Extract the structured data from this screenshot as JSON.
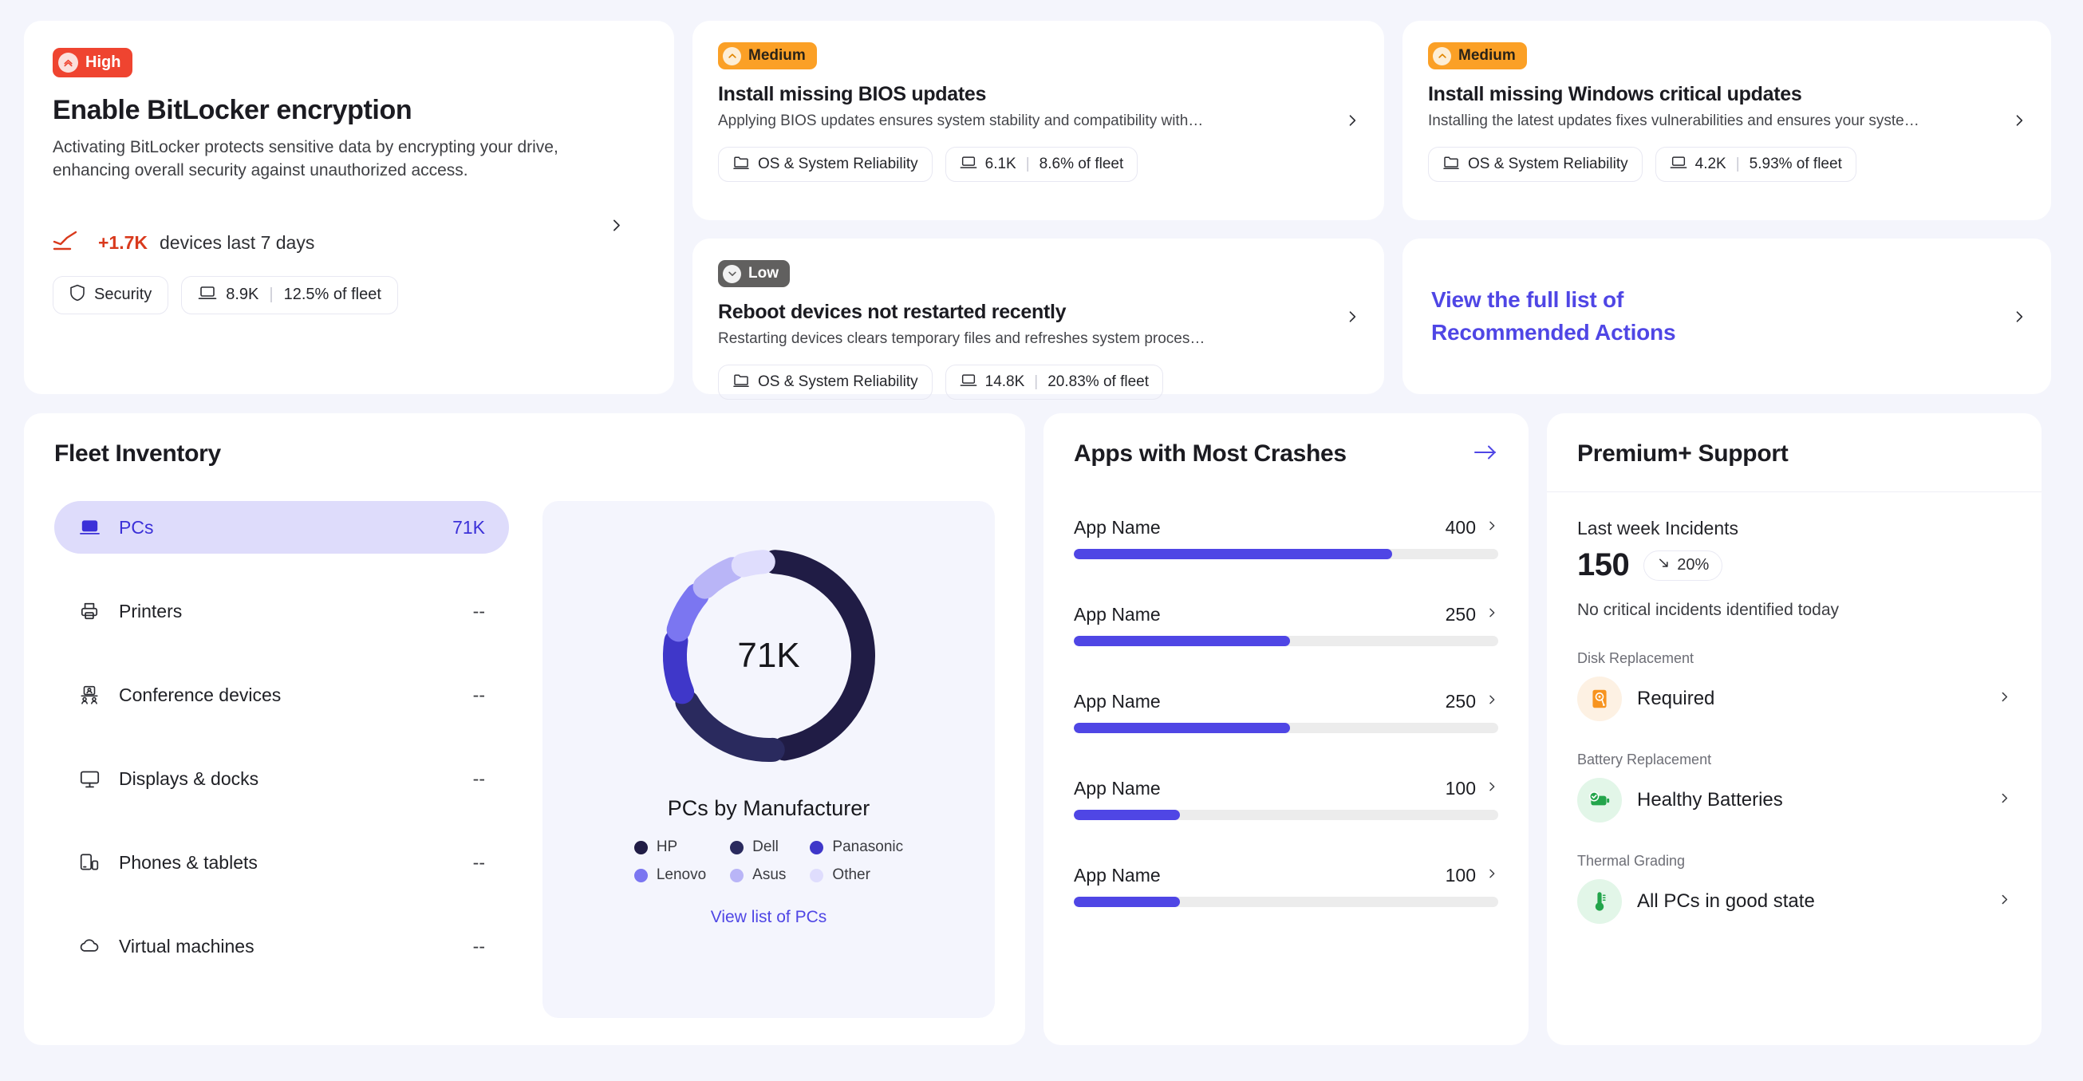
{
  "colors": {
    "background": "#f4f5fc",
    "card": "#ffffff",
    "accent": "#4f46e5",
    "severity_high": "#ef4430",
    "severity_medium": "#fba026",
    "severity_low": "#61605f",
    "trend_red": "#d93a1d",
    "active_row_bg": "#dedcfb",
    "active_row_text": "#3b30d8"
  },
  "recommendations": {
    "hero": {
      "severity": "High",
      "severity_icon": "chevrons-up-icon",
      "title": "Enable BitLocker encryption",
      "description": "Activating BitLocker protects sensitive data by encrypting your drive, enhancing overall security against unauthorized access.",
      "trend_icon": "trend-line-icon",
      "trend_value": "+1.7K",
      "trend_text": "devices last 7 days",
      "chips": [
        {
          "icon": "shield-icon",
          "label": "Security"
        },
        {
          "icon": "laptop-icon",
          "count": "8.9K",
          "percent": "12.5% of fleet"
        }
      ],
      "chevron_icon": "chevron-right-icon"
    },
    "cards": [
      {
        "severity": "Medium",
        "severity_icon": "chevron-up-icon",
        "title": "Install missing BIOS updates",
        "description": "Applying BIOS updates ensures system stability and compatibility with…",
        "chips": [
          {
            "icon": "folder-icon",
            "label": "OS & System Reliability"
          },
          {
            "icon": "laptop-icon",
            "count": "6.1K",
            "percent": "8.6% of fleet"
          }
        ],
        "chevron_icon": "chevron-right-icon"
      },
      {
        "severity": "Medium",
        "severity_icon": "chevron-up-icon",
        "title": "Install missing Windows critical updates",
        "description": "Installing the latest updates fixes vulnerabilities and ensures your syste…",
        "chips": [
          {
            "icon": "folder-icon",
            "label": "OS & System Reliability"
          },
          {
            "icon": "laptop-icon",
            "count": "4.2K",
            "percent": "5.93% of fleet"
          }
        ],
        "chevron_icon": "chevron-right-icon"
      },
      {
        "severity": "Low",
        "severity_icon": "chevron-down-icon",
        "title": "Reboot devices not restarted recently",
        "description": "Restarting devices clears temporary files and refreshes system proces…",
        "chips": [
          {
            "icon": "folder-icon",
            "label": "OS & System Reliability"
          },
          {
            "icon": "laptop-icon",
            "count": "14.8K",
            "percent": "20.83% of fleet"
          }
        ],
        "chevron_icon": "chevron-right-icon"
      }
    ],
    "full_list": {
      "line1": "View the full list of",
      "line2": "Recommended Actions",
      "chevron_icon": "chevron-right-icon"
    }
  },
  "fleet_inventory": {
    "title": "Fleet Inventory",
    "items": [
      {
        "icon": "laptop-icon",
        "label": "PCs",
        "count": "71K",
        "active": true
      },
      {
        "icon": "printer-icon",
        "label": "Printers",
        "count": "--",
        "active": false
      },
      {
        "icon": "conference-device-icon",
        "label": "Conference devices",
        "count": "--",
        "active": false
      },
      {
        "icon": "monitor-icon",
        "label": "Displays & docks",
        "count": "--",
        "active": false
      },
      {
        "icon": "phone-tablet-icon",
        "label": "Phones & tablets",
        "count": "--",
        "active": false
      },
      {
        "icon": "cloud-icon",
        "label": "Virtual machines",
        "count": "--",
        "active": false
      }
    ],
    "view_link": "View list of PCs"
  },
  "chart_data": {
    "type": "pie",
    "title": "PCs by Manufacturer",
    "center_label": "71K",
    "total": "71K",
    "legend_position": "bottom",
    "categories": [
      "HP",
      "Dell",
      "Panasonic",
      "Lenovo",
      "Asus",
      "Other"
    ],
    "values": [
      45,
      18,
      10,
      8,
      7,
      5
    ],
    "unit": "percent of PCs",
    "colors": [
      "#201c45",
      "#2a2a5e",
      "#3f37c9",
      "#7b76f1",
      "#b9b5f7",
      "#dfddfd"
    ]
  },
  "crashes": {
    "title": "Apps with Most Crashes",
    "arrow_icon": "arrow-right-icon",
    "rows": [
      {
        "name": "App Name",
        "value": "400",
        "pct": 75,
        "chevron_icon": "chevron-right-icon"
      },
      {
        "name": "App Name",
        "value": "250",
        "pct": 51,
        "chevron_icon": "chevron-right-icon"
      },
      {
        "name": "App Name",
        "value": "250",
        "pct": 51,
        "chevron_icon": "chevron-right-icon"
      },
      {
        "name": "App Name",
        "value": "100",
        "pct": 25,
        "chevron_icon": "chevron-right-icon"
      },
      {
        "name": "App Name",
        "value": "100",
        "pct": 25,
        "chevron_icon": "chevron-right-icon"
      }
    ]
  },
  "premium": {
    "title": "Premium+ Support",
    "incidents_label": "Last week Incidents",
    "incidents_value": "150",
    "incidents_delta": "20%",
    "incidents_delta_icon": "arrow-down-right-icon",
    "incidents_note": "No critical incidents identified today",
    "groups": [
      {
        "label": "Disk Replacement",
        "icon": "hard-disk-icon",
        "icon_tone": "orange",
        "status": "Required",
        "chevron_icon": "chevron-right-icon"
      },
      {
        "label": "Battery Replacement",
        "icon": "battery-check-icon",
        "icon_tone": "green",
        "status": "Healthy Batteries",
        "chevron_icon": "chevron-right-icon"
      },
      {
        "label": "Thermal Grading",
        "icon": "thermometer-icon",
        "icon_tone": "green",
        "status": "All PCs in good state",
        "chevron_icon": "chevron-right-icon"
      }
    ]
  }
}
